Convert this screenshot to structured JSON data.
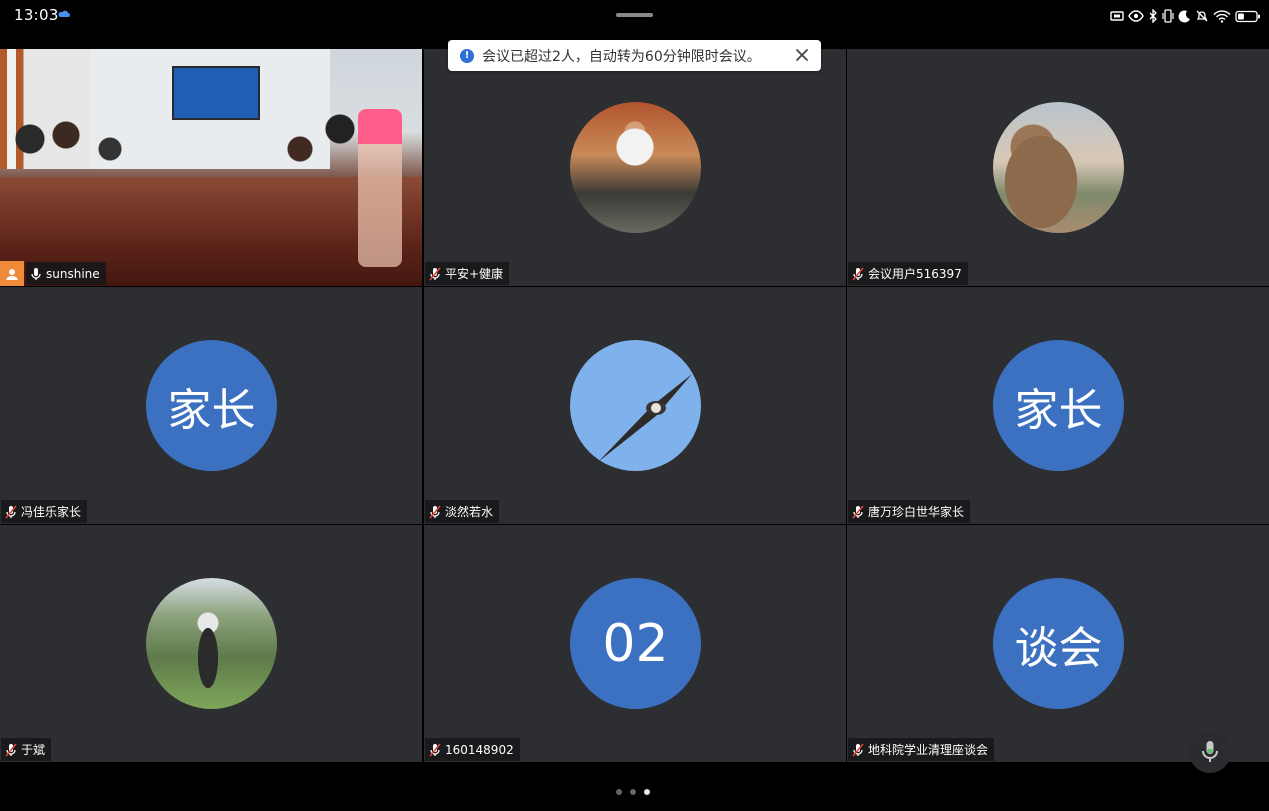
{
  "status_bar": {
    "time": "13:03",
    "icons": [
      "cloud-icon",
      "cast-icon",
      "eye-icon",
      "bluetooth-icon",
      "vibrate-icon",
      "moon-icon",
      "bell-off-icon",
      "wifi-icon",
      "battery-icon"
    ],
    "battery_level": 0.35
  },
  "toast": {
    "message": "会议已超过2人，自动转为60分钟限时会议。",
    "accent": "#2f6fd6"
  },
  "participants": [
    {
      "name": "sunshine",
      "avatar_text": "",
      "avatar_kind": "video",
      "mic": "on",
      "host": true
    },
    {
      "name": "平安+健康",
      "avatar_text": "",
      "avatar_kind": "photo-man-sofa",
      "mic": "off"
    },
    {
      "name": "会议用户516397",
      "avatar_text": "",
      "avatar_kind": "photo-teddy-bear",
      "mic": "off"
    },
    {
      "name": "冯佳乐家长",
      "avatar_text": "家长",
      "avatar_kind": "text",
      "mic": "off"
    },
    {
      "name": "淡然若水",
      "avatar_text": "",
      "avatar_kind": "photo-eagle-sky",
      "mic": "off"
    },
    {
      "name": "唐万珍白世华家长",
      "avatar_text": "家长",
      "avatar_kind": "text",
      "mic": "off"
    },
    {
      "name": "于斌",
      "avatar_text": "",
      "avatar_kind": "photo-man-tree",
      "mic": "off"
    },
    {
      "name": "160148902",
      "avatar_text": "02",
      "avatar_kind": "text",
      "mic": "off"
    },
    {
      "name": "地科院学业清理座谈会",
      "avatar_text": "谈会",
      "avatar_kind": "text",
      "mic": "off"
    }
  ],
  "colors": {
    "tile_bg": "#2c2e31",
    "avatar_blue": "#3c71c2",
    "host_orange": "#ef8a3a",
    "active_border": "#5cc46a",
    "mic_muted_red": "#e0443a"
  },
  "pagination": {
    "pages": 3,
    "current": 3
  }
}
